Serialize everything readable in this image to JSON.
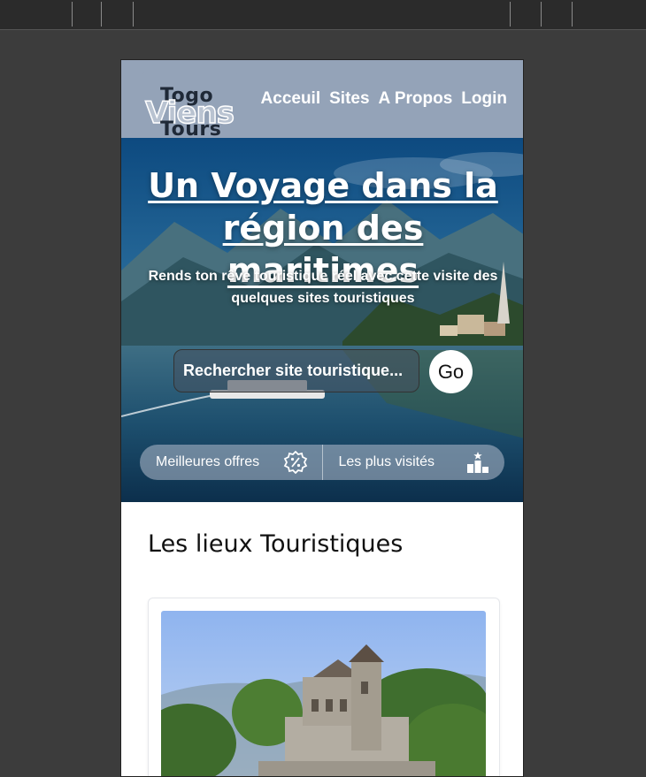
{
  "brand": {
    "logo_top": "Togo",
    "logo_middle": "Viens",
    "logo_bottom": "Tours"
  },
  "nav": {
    "items": [
      {
        "label": "Acceuil"
      },
      {
        "label": "Sites"
      },
      {
        "label": "A Propos"
      },
      {
        "label": "Login"
      }
    ]
  },
  "hero": {
    "title": "Un Voyage dans la région des maritimes",
    "subtitle": "Rends ton rêve touristique réel avec cette visite des quelques sites touristiques",
    "search_placeholder": "Rechercher site touristique...",
    "go_label": "Go",
    "filters": [
      {
        "label": "Meilleures offres",
        "icon": "percent-badge-icon"
      },
      {
        "label": "Les plus visités",
        "icon": "podium-icon"
      }
    ]
  },
  "main": {
    "section_title": "Les lieux Touristiques"
  },
  "colors": {
    "navbar": "#94a3b8",
    "page_background": "#ffffff",
    "workspace": "#3c3c3c"
  }
}
